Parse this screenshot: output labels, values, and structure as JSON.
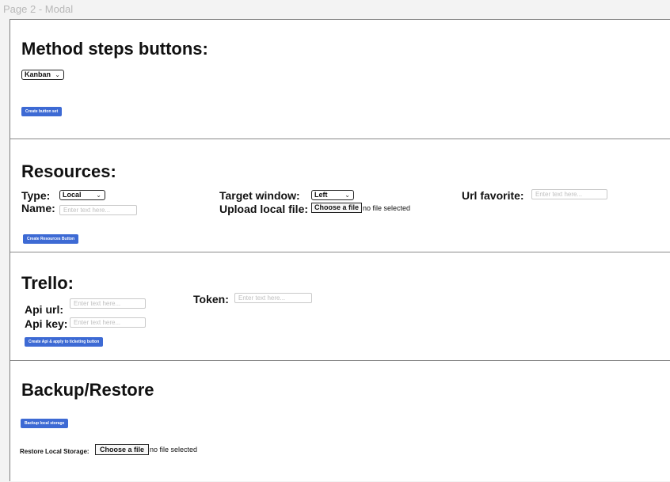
{
  "page": {
    "label": "Page 2 - Modal"
  },
  "method": {
    "heading": "Method steps buttons:",
    "select_value": "Kanban",
    "button_label": "Create button set"
  },
  "resources": {
    "heading": "Resources:",
    "type_label": "Type:",
    "type_value": "Local",
    "name_label": "Name:",
    "name_placeholder": "Enter text here...",
    "target_label": "Target window:",
    "target_value": "Left",
    "upload_label": "Upload local file:",
    "upload_button": "Choose a file",
    "upload_status": "no file selected",
    "url_label": "Url favorite:",
    "url_placeholder": "Enter text here...",
    "button_label": "Create Resources Button"
  },
  "trello": {
    "heading": "Trello:",
    "api_url_label": "Api url:",
    "api_url_placeholder": "Enter text here...",
    "api_key_label": "Api key:",
    "api_key_placeholder": "Enter text here...",
    "token_label": "Token:",
    "token_placeholder": "Enter text here...",
    "button_label": "Create Api & apply to ticketing button"
  },
  "backup": {
    "heading": "Backup/Restore",
    "button_label": "Backup local storage",
    "restore_label": "Restore Local Storage:",
    "restore_button": "Choose a file",
    "restore_status": "no file selected"
  },
  "icons": {
    "dropdown": "chevron-down-icon"
  },
  "colors": {
    "accent": "#3d6ad4",
    "border": "#8a8a8a",
    "page_label": "#b8b8b8"
  }
}
